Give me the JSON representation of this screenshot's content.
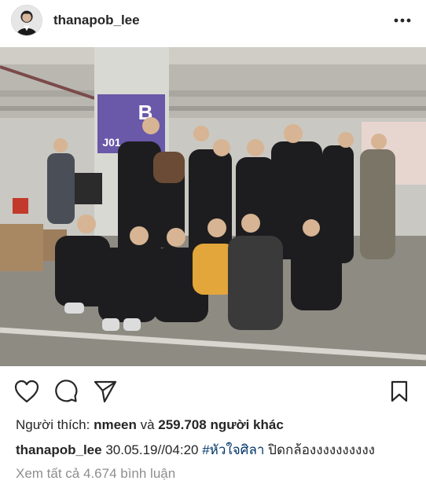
{
  "header": {
    "username": "thanapob_lee",
    "avatar_icon": "profile-avatar",
    "more_icon": "more-dots-icon"
  },
  "photo": {
    "signage_letter": "B",
    "signage_code": "J01"
  },
  "actions": {
    "like_icon": "heart-icon",
    "comment_icon": "comment-icon",
    "share_icon": "send-icon",
    "save_icon": "bookmark-icon"
  },
  "likes": {
    "prefix": "Người thích: ",
    "user": "nmeen",
    "joiner": " và ",
    "others": "259.708 người khác"
  },
  "caption": {
    "username": "thanapob_lee",
    "text": " 30.05.19//04:20 ",
    "hashtag": "#หัวใจศิลา",
    "suffix": " ปิดกล้องงงงงงงงงง"
  },
  "comments": {
    "label": "Xem tất cả 4.674 bình luận"
  },
  "colors": {
    "text": "#262626",
    "muted": "#8e8e8e",
    "hashtag": "#003569",
    "sign_purple": "#6a58a8"
  }
}
